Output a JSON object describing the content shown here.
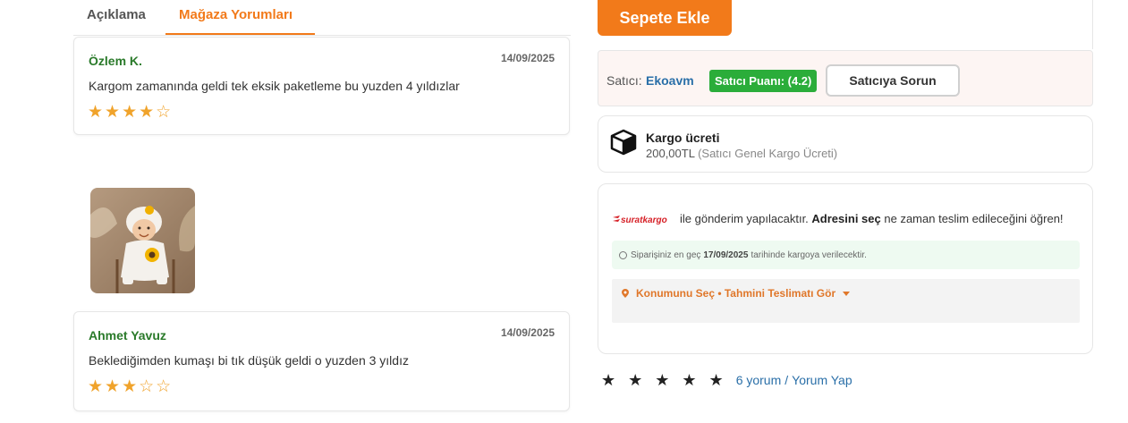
{
  "tabs": [
    {
      "label": "Açıklama",
      "active": false
    },
    {
      "label": "Mağaza Yorumları",
      "active": true
    }
  ],
  "reviews": [
    {
      "name": "Özlem K.",
      "date": "14/09/2025",
      "text": "Kargom zamanında geldi tek eksik paketleme bu yuzden 4 yıldızlar",
      "stars": "★★★★☆",
      "rating": 4
    },
    {
      "name": "Ahmet Yavuz",
      "date": "14/09/2025",
      "text": "Beklediğimden kumaşı bi tık düşük geldi o yuzden 3 yıldız",
      "stars": "★★★☆☆",
      "rating": 3
    }
  ],
  "add_to_cart": "Sepete Ekle",
  "seller": {
    "label": "Satıcı:",
    "name": "Ekoavm",
    "score": "Satıcı Puanı: (4.2)",
    "ask_button": "Satıcıya Sorun"
  },
  "shipping_fee": {
    "title": "Kargo ücreti",
    "amount": "200,00TL",
    "note": "(Satıcı Genel Kargo Ücreti)",
    "icon": "box-icon"
  },
  "delivery": {
    "carrier_logo": "suratkargo",
    "text_before": "ile gönderim yapılacaktır.",
    "text_bold": "Adresini seç",
    "text_after": "ne zaman teslim edileceğini öğren!",
    "deadline_before": "Siparişiniz en geç",
    "deadline_date": "17/09/2025",
    "deadline_after": "tarihinde kargoya verilecektir.",
    "location_link": "Konumunu Seç • Tahmini Teslimatı Gör"
  },
  "rating_summary": {
    "stars": "★★★★★",
    "reviews_link": "6 yorum",
    "separator": "/",
    "write_link": "Yorum Yap"
  },
  "colors": {
    "accent": "#f27a1a",
    "seller_score_bg": "#2bad3a",
    "link": "#2a6fa8",
    "reviewer_name": "#2a7a2a"
  }
}
